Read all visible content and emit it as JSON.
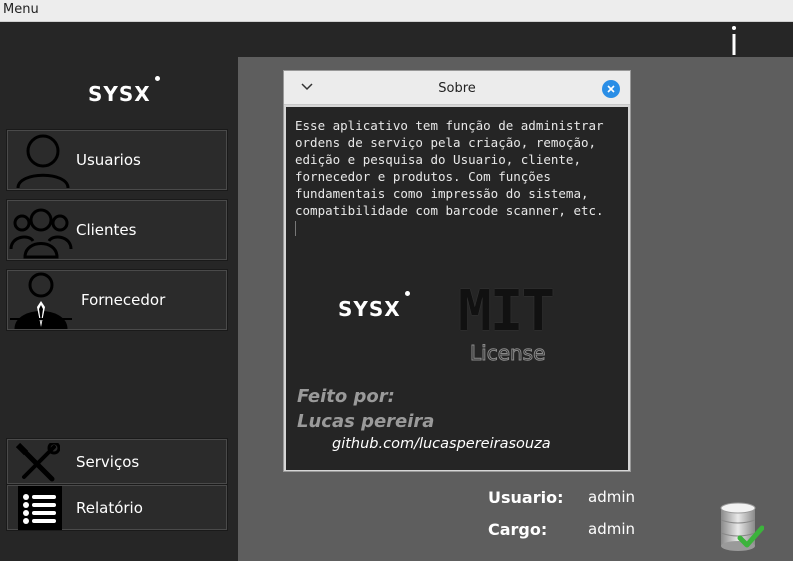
{
  "menubar": {
    "menu_label": "Menu"
  },
  "app": {
    "logo_text": "SYSX"
  },
  "sidebar": {
    "items": [
      {
        "label": "Usuarios",
        "icon": "user-icon"
      },
      {
        "label": "Clientes",
        "icon": "group-icon"
      },
      {
        "label": "Fornecedor",
        "icon": "supplier-icon"
      },
      {
        "label": "Serviços",
        "icon": "tools-icon"
      },
      {
        "label": "Relatório",
        "icon": "list-icon"
      }
    ]
  },
  "dialog": {
    "title": "Sobre",
    "description": "Esse aplicativo tem função de administrar\nordens de serviço pela criação, remoção,\nedição e pesquisa do Usuario, cliente,\nfornecedor e produtos. Com funções\nfundamentais como impressão do sistema,\ncompatibilidade com barcode scanner, etc.",
    "logo_text": "SYSX",
    "license_logo": "MIT",
    "license_text": "License",
    "made_by_label": "Feito por:",
    "author": "Lucas pereira",
    "github": "github.com/lucaspereirasouza"
  },
  "status": {
    "user_label": "Usuario:",
    "user_value": "admin",
    "role_label": "Cargo:",
    "role_value": "admin",
    "db_icon": "database-ok-icon"
  },
  "colors": {
    "sidebar_bg": "#262626",
    "content_bg": "#5e5e5e",
    "close_blue": "#2a8ee6",
    "db_check_green": "#3cb33c"
  }
}
